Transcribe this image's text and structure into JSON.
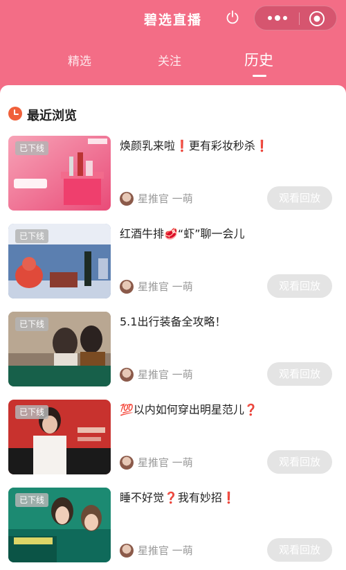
{
  "app": {
    "title": "碧选直播"
  },
  "colors": {
    "brand": "#f36d86",
    "clock": "#f0603a",
    "button": "#e4e4e4"
  },
  "tabs": [
    {
      "label": "精选",
      "active": false
    },
    {
      "label": "关注",
      "active": false
    },
    {
      "label": "历史",
      "active": true
    }
  ],
  "section": {
    "title": "最近浏览",
    "icon": "clock-icon"
  },
  "items": [
    {
      "badge": "已下线",
      "title": "焕颜乳来啦❗️更有彩妆秒杀❗️",
      "host": "星推官 一萌",
      "button": "观看回放"
    },
    {
      "badge": "已下线",
      "title": "红酒牛排🥩“虾”聊一会儿",
      "host": "星推官 一萌",
      "button": "观看回放"
    },
    {
      "badge": "已下线",
      "title": "5.1出行装备全攻略！",
      "host": "星推官 一萌",
      "button": "观看回放"
    },
    {
      "badge": "已下线",
      "title": "💯以内如何穿出明星范儿❓",
      "host": "星推官 一萌",
      "button": "观看回放"
    },
    {
      "badge": "已下线",
      "title": "睡不好觉❓我有妙招❗️",
      "host": "星推官 一萌",
      "button": "观看回放"
    }
  ]
}
